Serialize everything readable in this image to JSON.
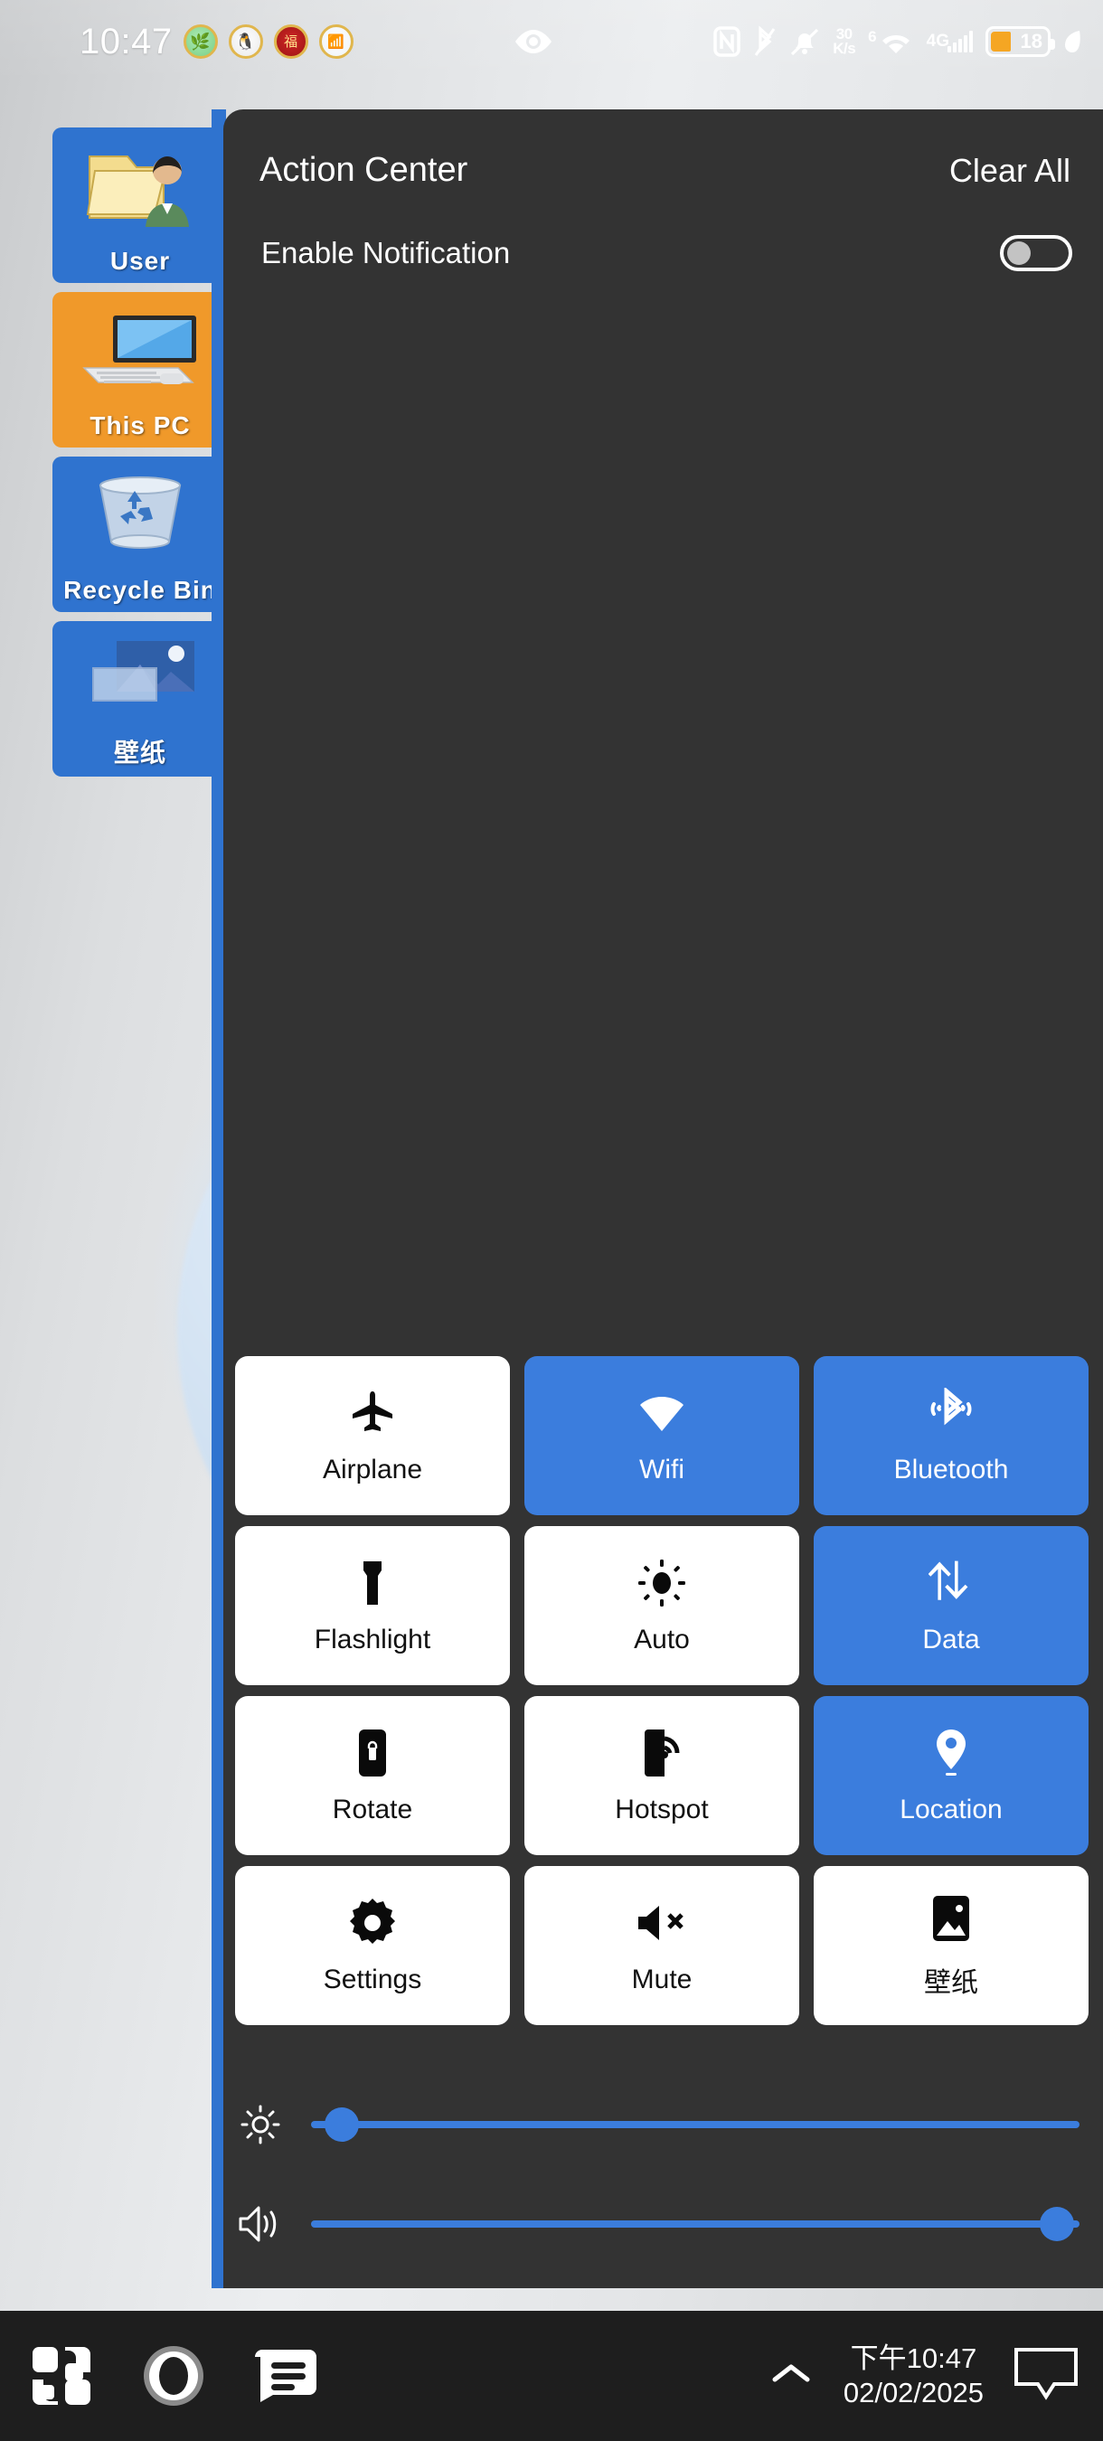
{
  "statusbar": {
    "clock": "10:47",
    "notification_icons": [
      {
        "name": "app-badge-green",
        "glyph": "🌿"
      },
      {
        "name": "app-badge-qq-penguin",
        "glyph": "🐧"
      },
      {
        "name": "app-badge-red-envelope",
        "glyph": "福"
      },
      {
        "name": "app-badge-china-mobile",
        "glyph": "📶"
      }
    ],
    "eye_icon": "eye-comfort-icon",
    "right_icons": [
      "nfc-icon",
      "bluetooth-off-icon",
      "bell-muted-icon"
    ],
    "network_speed": {
      "value": "30",
      "unit": "K/s"
    },
    "wifi": {
      "badge": "6",
      "label": "wifi-6-icon"
    },
    "cellular": {
      "generation": "4G",
      "bars": 5
    },
    "battery": {
      "percent": "18",
      "color": "#f5a623"
    }
  },
  "desktop": {
    "icons": [
      {
        "name": "user-folder",
        "label": "User",
        "color": "blue",
        "art": "user-folder-icon"
      },
      {
        "name": "this-pc",
        "label": "This PC",
        "color": "orange",
        "art": "monitor-keyboard-icon"
      },
      {
        "name": "recycle-bin",
        "label": "Recycle Bin",
        "color": "blue",
        "art": "recycle-bin-icon"
      },
      {
        "name": "wallpaper",
        "label": "壁纸",
        "color": "blue",
        "art": "wallpaper-picture-icon"
      }
    ]
  },
  "action_center": {
    "title": "Action Center",
    "clear_all_label": "Clear All",
    "enable_notification_label": "Enable Notification",
    "enable_notification_on": false,
    "accent_color": "#3b7ddd",
    "panel_color": "#333333",
    "tiles": [
      {
        "name": "airplane",
        "label": "Airplane",
        "icon": "airplane-icon",
        "active": false
      },
      {
        "name": "wifi",
        "label": "Wifi",
        "icon": "wifi-icon",
        "active": true
      },
      {
        "name": "bluetooth",
        "label": "Bluetooth",
        "icon": "bluetooth-icon",
        "active": true
      },
      {
        "name": "flashlight",
        "label": "Flashlight",
        "icon": "flashlight-icon",
        "active": false
      },
      {
        "name": "auto-brightness",
        "label": "Auto",
        "icon": "brightness-auto-icon",
        "active": false
      },
      {
        "name": "mobile-data",
        "label": "Data",
        "icon": "data-transfer-icon",
        "active": true
      },
      {
        "name": "rotate",
        "label": "Rotate",
        "icon": "rotation-lock-icon",
        "active": false
      },
      {
        "name": "hotspot",
        "label": "Hotspot",
        "icon": "hotspot-icon",
        "active": false
      },
      {
        "name": "location",
        "label": "Location",
        "icon": "location-pin-icon",
        "active": true
      },
      {
        "name": "settings",
        "label": "Settings",
        "icon": "gear-icon",
        "active": false
      },
      {
        "name": "mute",
        "label": "Mute",
        "icon": "speaker-mute-icon",
        "active": false
      },
      {
        "name": "wallpaper",
        "label": "壁纸",
        "icon": "picture-icon",
        "active": false
      }
    ],
    "sliders": [
      {
        "name": "brightness",
        "icon": "brightness-icon",
        "value": 4
      },
      {
        "name": "volume",
        "icon": "volume-icon",
        "value": 97
      }
    ]
  },
  "taskbar": {
    "buttons": [
      {
        "name": "start-button",
        "icon": "start-squares-icon"
      },
      {
        "name": "cortana-button",
        "icon": "cortana-circle-icon"
      },
      {
        "name": "task-view-button",
        "icon": "task-view-icon"
      }
    ],
    "tray_chevron": "chevron-up-icon",
    "time": "下午10:47",
    "date": "02/02/2025",
    "notification_center_icon": "notification-balloon-icon"
  }
}
